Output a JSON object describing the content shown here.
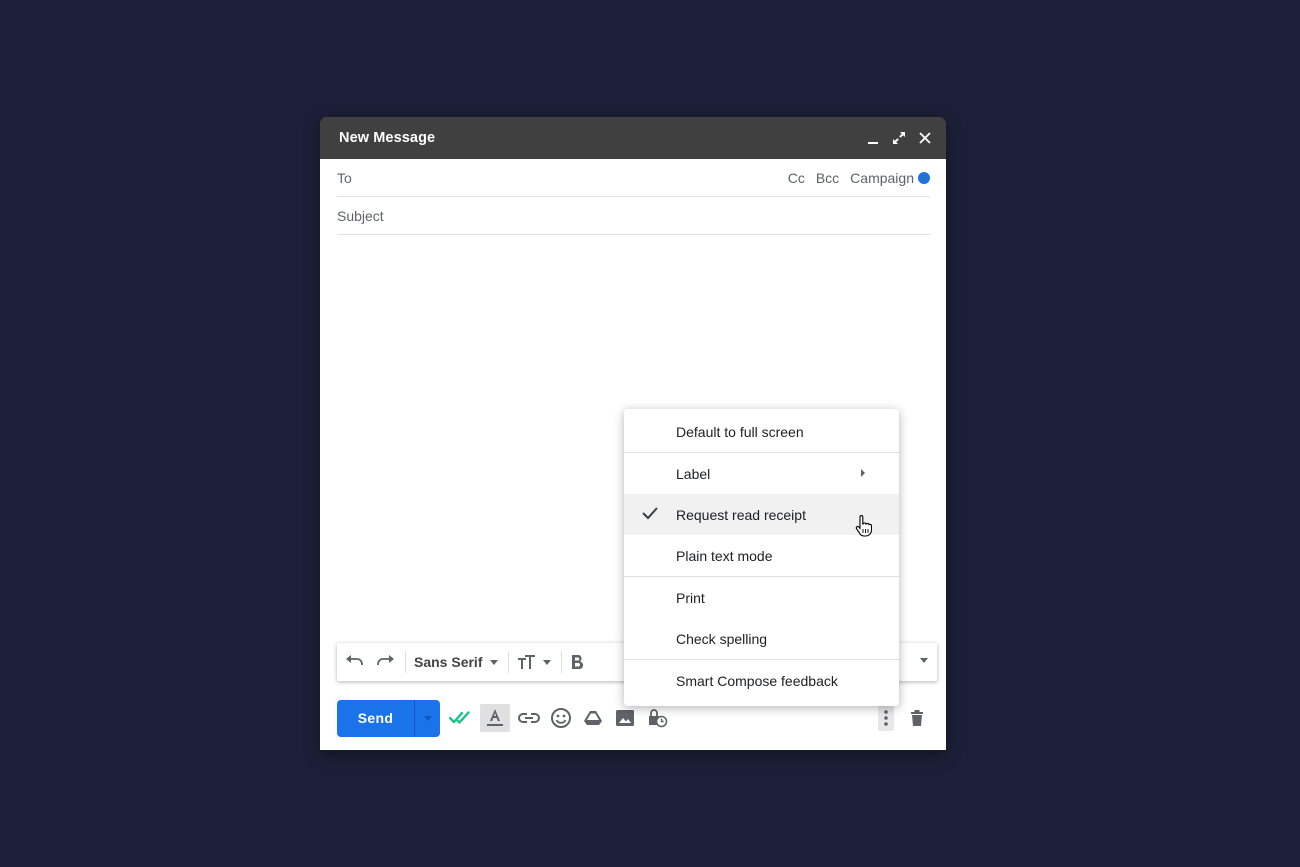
{
  "window": {
    "title": "New Message"
  },
  "fields": {
    "to_label": "To",
    "cc": "Cc",
    "bcc": "Bcc",
    "campaign": "Campaign",
    "subject_placeholder": "Subject"
  },
  "format_bar": {
    "font": "Sans Serif"
  },
  "bottom_bar": {
    "send_label": "Send"
  },
  "menu": {
    "items": [
      {
        "label": "Default to full screen"
      },
      {
        "label": "Label",
        "has_submenu": true
      },
      {
        "label": "Request read receipt",
        "checked": true
      },
      {
        "label": "Plain text mode"
      },
      {
        "label": "Print"
      },
      {
        "label": "Check spelling"
      },
      {
        "label": "Smart Compose feedback"
      }
    ]
  },
  "colors": {
    "background": "#1c1f37",
    "titlebar": "#404040",
    "accent": "#1a73e8",
    "check_green": "#1ec28b"
  },
  "icons": [
    "minimize-icon",
    "expand-icon",
    "close-icon",
    "info-icon",
    "undo-icon",
    "redo-icon",
    "text-size-icon",
    "bold-icon",
    "double-check-icon",
    "format-text-icon",
    "link-icon",
    "emoji-icon",
    "drive-icon",
    "image-icon",
    "confidential-icon",
    "more-vert-icon",
    "trash-icon",
    "check-icon",
    "hand-cursor-icon"
  ]
}
